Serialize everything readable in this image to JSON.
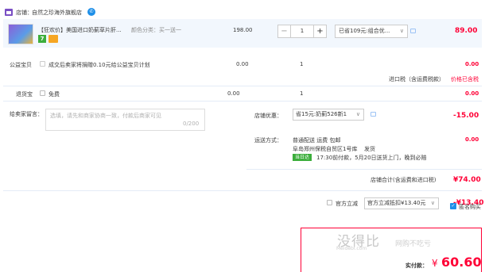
{
  "shop": {
    "label": "店铺：",
    "name": "自然之珍海外旗舰店"
  },
  "item": {
    "title": "【狂欢价】美国进口奶蓟草片肝...",
    "sku": "颜色分类：买一送一",
    "unit_price": "198.00",
    "quantity": "1",
    "minus": "−",
    "plus": "+",
    "promo": "已省109元:组合优...",
    "subtotal": "89.00"
  },
  "charity": {
    "label": "公益宝贝",
    "text": "成交后卖家将捐赠0.10元给公益宝贝计划",
    "price": "0.00",
    "qty": "1",
    "amount": "0.00",
    "tax_label": "进口税（含运费税款）",
    "tax_value": "价格已含税"
  },
  "return_ins": {
    "label": "退货宝",
    "text": "免费",
    "price": "0.00",
    "qty": "1",
    "amount": "0.00"
  },
  "message": {
    "label": "给卖家留言：",
    "placeholder": "选填，请先和商家协商一致，付款后商家可见",
    "counter": "0/200"
  },
  "shop_discount": {
    "label": "店铺优惠：",
    "selected": "省15元:奶蓟526新1",
    "amount": "-15.00"
  },
  "shipping": {
    "label": "运送方式：",
    "method": "普通配送 运费 包邮",
    "warehouse": "阜岛郑州保税自贸区1号库",
    "ship_text": "发货",
    "badge": "当日达",
    "eta": "17:30前付款，5月20日送货上门，晚到必赔",
    "amount": "0.00"
  },
  "shop_total": {
    "label": "店铺合计(含运费和进口税)",
    "amount": "¥74.00"
  },
  "official": {
    "label": "官方立减",
    "selected": "官方立减抵扣¥13.40元",
    "amount": "-¥13.40"
  },
  "anonymous": {
    "label": "匿名购买"
  },
  "pay": {
    "label": "实付款：",
    "currency": "¥",
    "amount": "60.60"
  },
  "watermark": {
    "text": "没得比",
    "slogan": "网购不吃亏",
    "url": "Meidebi.com"
  },
  "colors": {
    "accent_red": "#ff0036",
    "blue": "#1e8fe8",
    "green": "#3cae3c"
  },
  "icons": [
    "shop-icon",
    "wangwang-icon",
    "chevron-down-icon",
    "chat-icon",
    "checkbox-icon",
    "check-icon"
  ]
}
